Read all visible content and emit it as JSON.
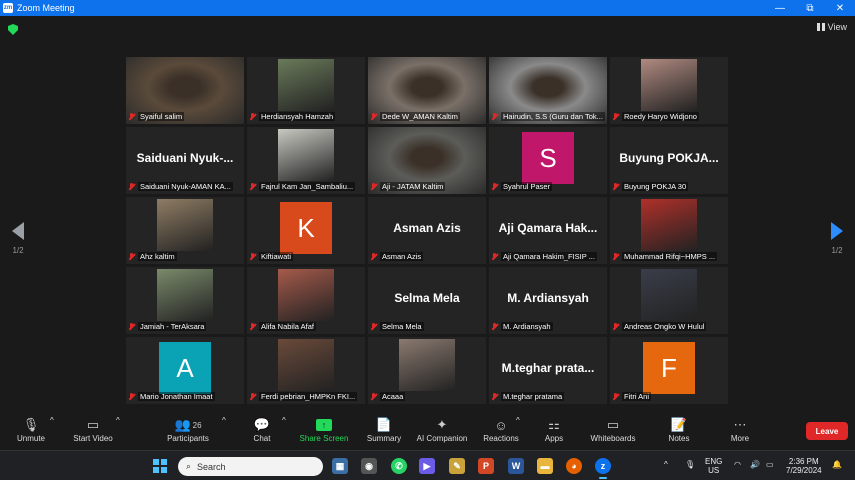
{
  "window": {
    "title": "Zoom Meeting",
    "controls": [
      "—",
      "⧉",
      "✕"
    ]
  },
  "topbar": {
    "view_label": "View"
  },
  "pager": {
    "left": "1/2",
    "right": "1/2"
  },
  "participants": [
    {
      "name": "Syaiful salim",
      "kind": "video",
      "color": "#5a4a3a"
    },
    {
      "name": "Herdiansyah Hamzah",
      "kind": "photo",
      "color": "#6a7a5a"
    },
    {
      "name": "Dede W_AMAN Kaltim",
      "kind": "video",
      "color": "#7a7068"
    },
    {
      "name": "Hairudin, S.S (Guru dan Tok...",
      "kind": "video",
      "color": "#8a8a8a",
      "active": true
    },
    {
      "name": "Roedy Haryo Widjono",
      "kind": "photo",
      "color": "#b08a80"
    },
    {
      "name": "Saiduani Nyuk-AMAN KA...",
      "kind": "text",
      "display": "Saiduani Nyuk-..."
    },
    {
      "name": "Fajrul Kam Jan_Sambaliu...",
      "kind": "photo",
      "color": "#c9c9c2"
    },
    {
      "name": "Aji - JATAM Kaltim",
      "kind": "video",
      "color": "#5c5c58"
    },
    {
      "name": "Syahrul Paser",
      "kind": "avatar",
      "initial": "S",
      "color": "#c0176b"
    },
    {
      "name": "Buyung POKJA 30",
      "kind": "text",
      "display": "Buyung  POKJA..."
    },
    {
      "name": "Ahz kaltim",
      "kind": "photo",
      "color": "#8f7d64"
    },
    {
      "name": "Kiftiawati",
      "kind": "avatar",
      "initial": "K",
      "color": "#d8491b"
    },
    {
      "name": "Asman Azis",
      "kind": "text",
      "display": "Asman Azis"
    },
    {
      "name": "Aji Qamara Hakim_FISIP ...",
      "kind": "text",
      "display": "Aji  Qamara  Hak..."
    },
    {
      "name": "Muhammad Rifqi~HMPS ...",
      "kind": "photo",
      "color": "#b0302a"
    },
    {
      "name": "Jamiah - TerAksara",
      "kind": "photo",
      "color": "#7a8a6a"
    },
    {
      "name": "Alifa Nabila Afaf",
      "kind": "photo",
      "color": "#a55a4a"
    },
    {
      "name": "Selma Mela",
      "kind": "text",
      "display": "Selma Mela"
    },
    {
      "name": "M. Ardiansyah",
      "kind": "text",
      "display": "M. Ardiansyah"
    },
    {
      "name": "Andreas Ongko W Hulul",
      "kind": "photo",
      "color": "#3a3e4a"
    },
    {
      "name": "Mario Jonathan Imaat",
      "kind": "avatar",
      "initial": "A",
      "color": "#0aa2b5"
    },
    {
      "name": "Ferdi pebrian_HMPKn FKI...",
      "kind": "photo",
      "color": "#6a4a3a"
    },
    {
      "name": "Acaaa",
      "kind": "photo",
      "color": "#8a7a70"
    },
    {
      "name": "M.teghar pratama",
      "kind": "text",
      "display": "M.teghar  prata..."
    },
    {
      "name": "Fitri Ani",
      "kind": "avatar",
      "initial": "F",
      "color": "#e5680e"
    }
  ],
  "toolbar": {
    "unmute": "Unmute",
    "start_video": "Start Video",
    "participants": "Participants",
    "participants_count": "26",
    "chat": "Chat",
    "share_screen": "Share Screen",
    "summary": "Summary",
    "ai_companion": "AI Companion",
    "reactions": "Reactions",
    "apps": "Apps",
    "whiteboards": "Whiteboards",
    "notes": "Notes",
    "more": "More",
    "leave": "Leave"
  },
  "taskbar": {
    "search_placeholder": "Search",
    "lang_top": "ENG",
    "lang_bottom": "US",
    "time": "2:36 PM",
    "date": "7/29/2024"
  }
}
